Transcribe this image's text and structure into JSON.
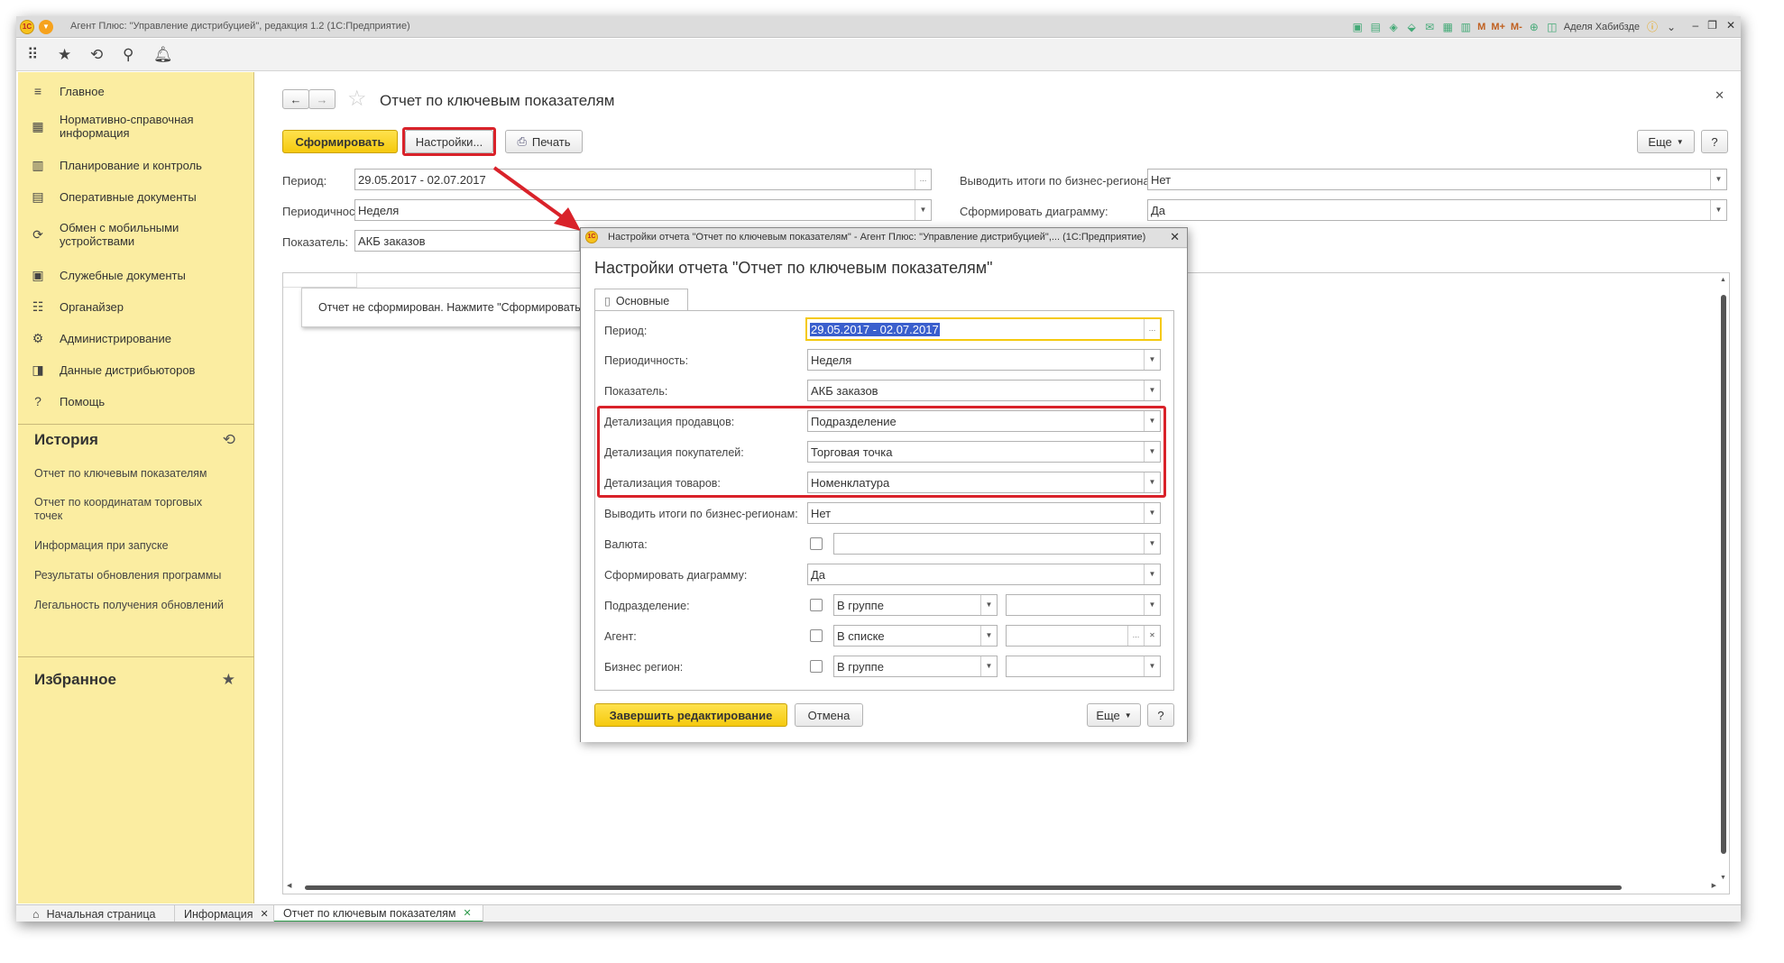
{
  "window": {
    "title": "Агент Плюс: \"Управление дистрибуцией\", редакция 1.2 (1С:Предприятие)",
    "user": "Аделя Хабибзде",
    "m_labels": [
      "M",
      "M+",
      "M-"
    ],
    "logo": "1С"
  },
  "sidebar": {
    "items": [
      {
        "icon": "≡",
        "label": "Главное"
      },
      {
        "icon": "▦",
        "label": "Нормативно-справочная информация"
      },
      {
        "icon": "▥",
        "label": "Планирование и контроль"
      },
      {
        "icon": "▤",
        "label": "Оперативные документы"
      },
      {
        "icon": "⟳",
        "label": "Обмен с мобильными устройствами"
      },
      {
        "icon": "▣",
        "label": "Служебные документы"
      },
      {
        "icon": "☷",
        "label": "Органайзер"
      },
      {
        "icon": "⚙",
        "label": "Администрирование"
      },
      {
        "icon": "◨",
        "label": "Данные дистрибьюторов"
      },
      {
        "icon": "?",
        "label": "Помощь"
      }
    ],
    "history_title": "История",
    "history_items": [
      "Отчет по ключевым показателям",
      "Отчет по координатам торговых точек",
      "Информация при запуске",
      "Результаты обновления программы",
      "Легальность получения обновлений"
    ],
    "favorites_title": "Избранное"
  },
  "main": {
    "title": "Отчет по ключевым показателям",
    "btn_form": "Сформировать",
    "btn_settings": "Настройки...",
    "btn_print": "Печать",
    "btn_more": "Еще",
    "btn_help": "?",
    "period_label": "Период:",
    "period_value": "29.05.2017 - 02.07.2017",
    "periodicity_label": "Периодичность:",
    "periodicity_value": "Неделя",
    "indicator_label": "Показатель:",
    "indicator_value": "АКБ заказов",
    "regions_label": "Выводить итоги по бизнес-регионам:",
    "regions_value": "Нет",
    "diagram_label": "Сформировать диаграмму:",
    "diagram_value": "Да",
    "not_formed": "Отчет не сформирован. Нажмите \"Сформировать\" д"
  },
  "dialog": {
    "window_title": "Настройки отчета \"Отчет по ключевым показателям\" - Агент Плюс: \"Управление дистрибуцией\",... (1С:Предприятие)",
    "title": "Настройки отчета \"Отчет по ключевым показателям\"",
    "tab": "Основные",
    "rows": {
      "period": {
        "label": "Период:",
        "value": "29.05.2017 - 02.07.2017"
      },
      "periodicity": {
        "label": "Периодичность:",
        "value": "Неделя"
      },
      "indicator": {
        "label": "Показатель:",
        "value": "АКБ заказов"
      },
      "sellers": {
        "label": "Детализация продавцов:",
        "value": "Подразделение"
      },
      "buyers": {
        "label": "Детализация покупателей:",
        "value": "Торговая точка"
      },
      "goods": {
        "label": "Детализация товаров:",
        "value": "Номенклатура"
      },
      "regions": {
        "label": "Выводить итоги по бизнес-регионам:",
        "value": "Нет"
      },
      "currency": {
        "label": "Валюта:",
        "value": ""
      },
      "diagram": {
        "label": "Сформировать диаграмму:",
        "value": "Да"
      },
      "division": {
        "label": "Подразделение:",
        "mode": "В группе",
        "value": ""
      },
      "agent": {
        "label": "Агент:",
        "mode": "В списке",
        "value": ""
      },
      "bizregion": {
        "label": "Бизнес регион:",
        "mode": "В группе",
        "value": ""
      }
    },
    "btn_finish": "Завершить редактирование",
    "btn_cancel": "Отмена",
    "btn_more": "Еще",
    "btn_help": "?"
  },
  "taskbar": {
    "home": "Начальная страница",
    "info": "Информация",
    "report": "Отчет по ключевым показателям"
  },
  "colors": {
    "sidebar": "#fbeda1",
    "accent": "#f5c90e",
    "highlight": "#d9222a",
    "selection": "#3a5fcd"
  }
}
